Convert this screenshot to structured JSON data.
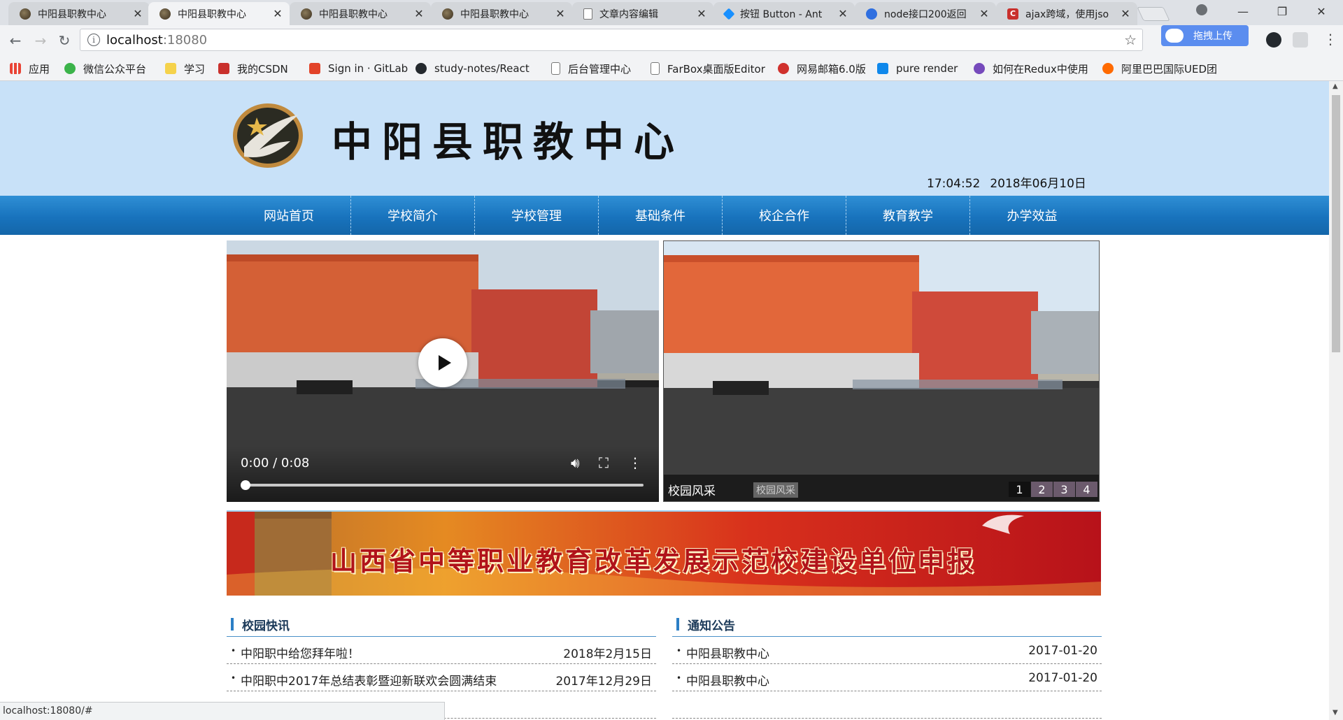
{
  "browser": {
    "tabs": [
      {
        "title": "中阳县职教中心",
        "icon": "school-favicon",
        "active": false
      },
      {
        "title": "中阳县职教中心",
        "icon": "school-favicon",
        "active": true
      },
      {
        "title": "中阳县职教中心",
        "icon": "school-favicon",
        "active": false
      },
      {
        "title": "中阳县职教中心",
        "icon": "school-favicon",
        "active": false
      },
      {
        "title": "文章内容编辑",
        "icon": "document-icon",
        "active": false
      },
      {
        "title": "按钮 Button - Ant",
        "icon": "ant-design-icon",
        "active": false
      },
      {
        "title": "node接口200返回",
        "icon": "baidu-paw-icon",
        "active": false
      },
      {
        "title": "ajax跨域，使用jso",
        "icon": "csdn-icon",
        "active": false
      }
    ],
    "url_host": "localhost",
    "url_port": ":18080",
    "extension_label": "拖拽上传",
    "bookmarks": [
      {
        "label": "应用",
        "icon": "apps-grid-icon"
      },
      {
        "label": "微信公众平台",
        "icon": "wechat-icon"
      },
      {
        "label": "学习",
        "icon": "folder-icon"
      },
      {
        "label": "我的CSDN",
        "icon": "csdn-icon"
      },
      {
        "label": "Sign in · GitLab",
        "icon": "gitlab-icon"
      },
      {
        "label": "study-notes/React",
        "icon": "github-icon"
      },
      {
        "label": "后台管理中心",
        "icon": "document-icon"
      },
      {
        "label": "FarBox桌面版Editor",
        "icon": "document-icon"
      },
      {
        "label": "网易邮箱6.0版",
        "icon": "netease-icon"
      },
      {
        "label": "pure render",
        "icon": "zhihu-icon"
      },
      {
        "label": "如何在Redux中使用",
        "icon": "redux-icon"
      },
      {
        "label": "阿里巴巴国际UED团",
        "icon": "alibaba-icon"
      }
    ],
    "status_text": "localhost:18080/#"
  },
  "site": {
    "title": "中阳县职教中心",
    "time": "17:04:52",
    "date": "2018年06月10日",
    "nav": [
      "网站首页",
      "学校简介",
      "学校管理",
      "基础条件",
      "校企合作",
      "教育教学",
      "办学效益"
    ],
    "video": {
      "time_display": "0:00 / 0:08",
      "progress": 0
    },
    "slideshow": {
      "caption": "校园风采",
      "caption_alt": "校园风采",
      "pages": [
        "1",
        "2",
        "3",
        "4"
      ],
      "current": 1
    },
    "banner_text": "山西省中等职业教育改革发展示范校建设单位申报",
    "news": {
      "heading": "校园快讯",
      "items": [
        {
          "title": "中阳职中给您拜年啦！",
          "date": "2018年2月15日"
        },
        {
          "title": "中阳职中2017年总结表彰暨迎新联欢会圆满结束",
          "date": "2017年12月29日"
        },
        {
          "title": "",
          "date": ""
        }
      ]
    },
    "notices": {
      "heading": "通知公告",
      "items": [
        {
          "title": "中阳县职教中心",
          "date": "2017-01-20"
        },
        {
          "title": "中阳县职教中心",
          "date": "2017-01-20"
        },
        {
          "title": "",
          "date": ""
        }
      ]
    }
  },
  "colors": {
    "header_bg": "#c8e1f8",
    "nav_blue": "#1873bd",
    "banner_red": "#c8191c"
  }
}
